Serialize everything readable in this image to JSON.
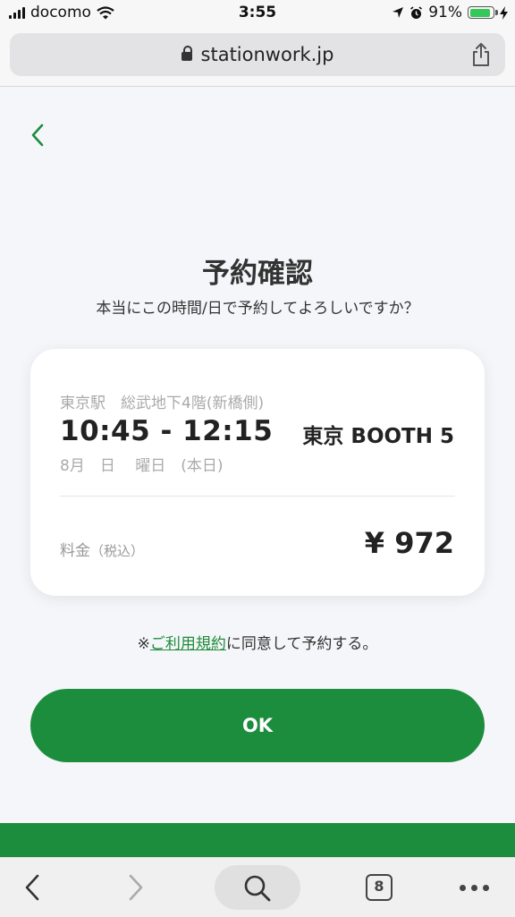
{
  "status_bar": {
    "carrier": "docomo",
    "time": "3:55",
    "battery": "91%",
    "battery_level": 0.91
  },
  "browser": {
    "url": "stationwork.jp",
    "tab_count": "8"
  },
  "page": {
    "title": "予約確認",
    "subtitle": "本当にこの時間/日で予約してよろしいですか？",
    "card": {
      "location": "東京駅　総武地下4階(新橋側)",
      "time_range": "10:45 - 12:15",
      "booth": "東京 BOOTH 5",
      "date": "8月　日　 曜日　(本日)",
      "fee_label": "料金",
      "fee_tax": "（税込）",
      "fee_value": "¥ 972"
    },
    "agree_prefix": "※",
    "agree_link": "ご利用規約",
    "agree_suffix": "に同意して予約する。",
    "ok_label": "OK"
  },
  "colors": {
    "accent": "#1c8d3d",
    "background": "#f5f6f9"
  }
}
